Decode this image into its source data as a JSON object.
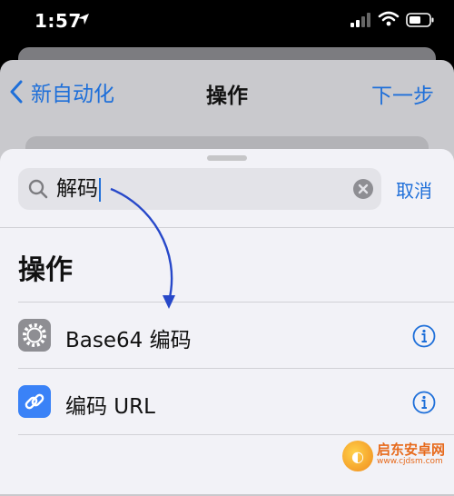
{
  "status_bar": {
    "time": "1:57"
  },
  "nav": {
    "back_label": "新自动化",
    "title": "操作",
    "next_label": "下一步"
  },
  "search": {
    "query": "解码",
    "cancel_label": "取消"
  },
  "section_title": "操作",
  "actions": [
    {
      "label": "Base64 编码",
      "icon": "gear-icon",
      "icon_color": "#8e8e93"
    },
    {
      "label": "编码 URL",
      "icon": "link-icon",
      "icon_color": "#3a82f7"
    }
  ],
  "watermark": {
    "text": "启东安卓网",
    "url": "www.cjdsm.com"
  },
  "colors": {
    "accent": "#1e6fd9",
    "annotation_arrow": "#2748c9"
  }
}
